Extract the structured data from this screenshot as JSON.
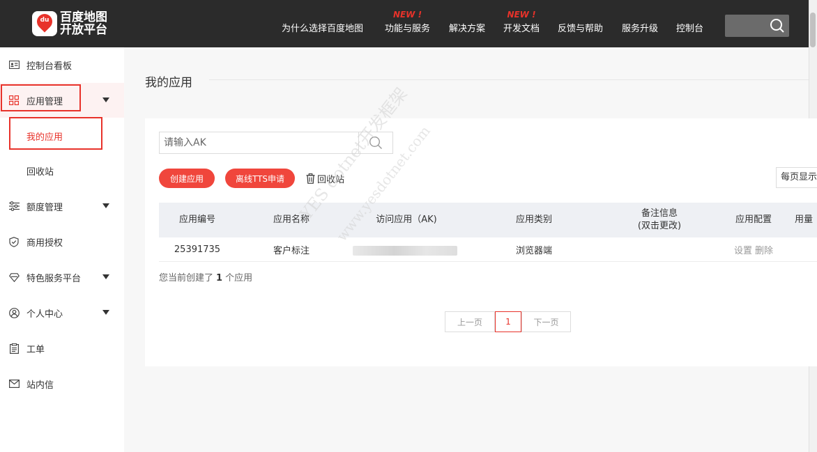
{
  "header": {
    "logo_line1": "百度地图",
    "logo_line2": "开放平台",
    "logo_badge": "du",
    "nav": [
      {
        "label": "为什么选择百度地图",
        "new": ""
      },
      {
        "label": "功能与服务",
        "new": "NEW !"
      },
      {
        "label": "解决方案",
        "new": ""
      },
      {
        "label": "开发文档",
        "new": "NEW !"
      },
      {
        "label": "反馈与帮助",
        "new": ""
      },
      {
        "label": "服务升级",
        "new": ""
      },
      {
        "label": "控制台",
        "new": ""
      }
    ]
  },
  "sidebar": {
    "items": [
      {
        "label": "控制台看板"
      },
      {
        "label": "应用管理"
      },
      {
        "label": "我的应用"
      },
      {
        "label": "回收站"
      },
      {
        "label": "额度管理"
      },
      {
        "label": "商用授权"
      },
      {
        "label": "特色服务平台"
      },
      {
        "label": "个人中心"
      },
      {
        "label": "工单"
      },
      {
        "label": "站内信"
      }
    ]
  },
  "main": {
    "title": "我的应用",
    "search_placeholder": "请输入AK",
    "create_button": "创建应用",
    "tts_button": "离线TTS申请",
    "recycle_link": "回收站",
    "per_page": "每页显示",
    "table": {
      "columns": [
        "应用编号",
        "应用名称",
        "访问应用（AK)",
        "应用类别",
        "备注信息",
        "(双击更改)",
        "应用配置",
        "用量"
      ],
      "rows": [
        {
          "id": "25391735",
          "name": "客户标注",
          "ak": "",
          "category": "浏览器端",
          "remark": "",
          "actions": [
            "设置",
            "删除"
          ]
        }
      ]
    },
    "summary_prefix": "您当前创建了",
    "summary_count": "1",
    "summary_suffix": "个应用",
    "pagination": {
      "prev": "上一页",
      "current": "1",
      "next": "下一页"
    }
  },
  "watermark": {
    "line1": "YES dotnet开发框架",
    "line2": "www.yesdotnet.com"
  },
  "colors": {
    "accent": "#e8322a",
    "header_bg": "#2b2b2b",
    "button_red": "#f0463c"
  }
}
